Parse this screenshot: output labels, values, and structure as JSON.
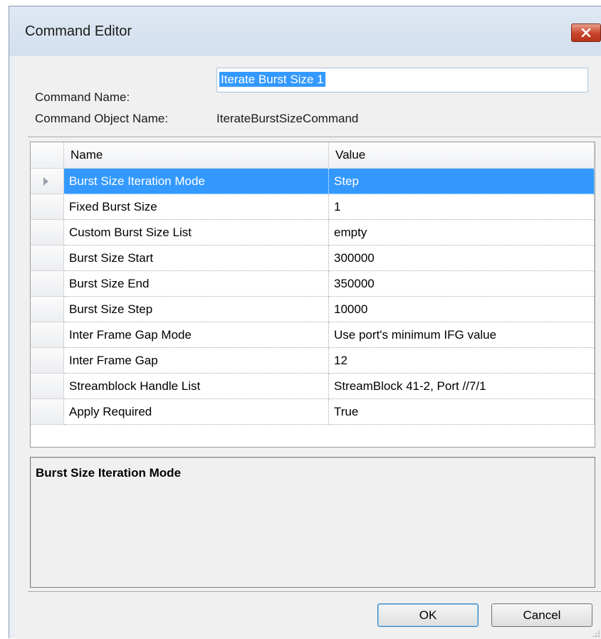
{
  "window": {
    "title": "Command Editor"
  },
  "form": {
    "command_name_label": "Command Name:",
    "command_name_value": "Iterate Burst Size 1",
    "command_object_label": "Command Object Name:",
    "command_object_value": "IterateBurstSizeCommand"
  },
  "grid": {
    "columns": [
      "Name",
      "Value"
    ],
    "selected_row": 0,
    "rows": [
      {
        "name": "Burst Size Iteration Mode",
        "value": "Step"
      },
      {
        "name": "Fixed Burst Size",
        "value": "1"
      },
      {
        "name": "Custom Burst Size List",
        "value": "empty"
      },
      {
        "name": "Burst Size Start",
        "value": "300000"
      },
      {
        "name": "Burst Size End",
        "value": "350000"
      },
      {
        "name": "Burst Size Step",
        "value": "10000"
      },
      {
        "name": "Inter Frame Gap Mode",
        "value": "Use port's minimum IFG value"
      },
      {
        "name": "Inter Frame Gap",
        "value": "12"
      },
      {
        "name": "Streamblock Handle List",
        "value": "StreamBlock 41-2, Port //7/1"
      },
      {
        "name": "Apply Required",
        "value": "True"
      }
    ]
  },
  "help": {
    "title": "Burst Size Iteration Mode"
  },
  "buttons": {
    "ok": "OK",
    "cancel": "Cancel"
  },
  "colors": {
    "selection": "#3399ff",
    "close_button": "#c7432a"
  }
}
